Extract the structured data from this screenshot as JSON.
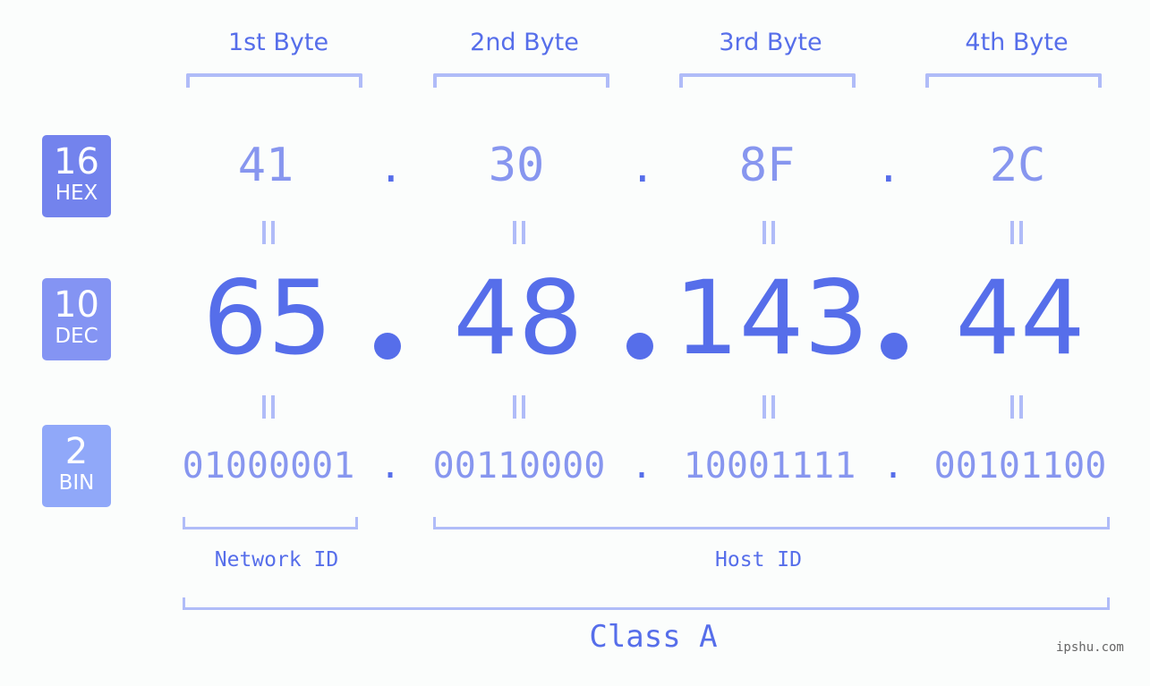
{
  "ip_address": "65.48.143.44",
  "byte_headers": [
    "1st Byte",
    "2nd Byte",
    "3rd Byte",
    "4th Byte"
  ],
  "bases": {
    "hex": {
      "number": "16",
      "label": "HEX",
      "color": "#7383ed"
    },
    "dec": {
      "number": "10",
      "label": "DEC",
      "color": "#8494f3"
    },
    "bin": {
      "number": "2",
      "label": "BIN",
      "color": "#90a8f9"
    }
  },
  "hex_values": [
    "41",
    "30",
    "8F",
    "2C"
  ],
  "dec_values": [
    "65",
    "48",
    "143",
    "44"
  ],
  "bin_values": [
    "01000001",
    "00110000",
    "10001111",
    "00101100"
  ],
  "separator": ".",
  "equals_symbol": "=",
  "network_id_label": "Network ID",
  "host_id_label": "Host ID",
  "class_label": "Class A",
  "watermark": "ipshu.com",
  "colors": {
    "primary": "#566eea",
    "secondary": "#8796ef",
    "bracket": "#b0bcf8",
    "background": "#fbfdfc"
  }
}
